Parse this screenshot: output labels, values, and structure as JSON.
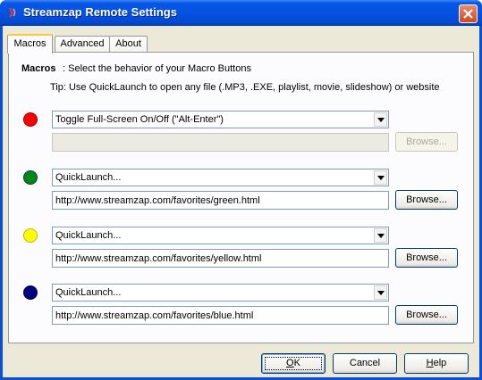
{
  "window": {
    "title": "Streamzap Remote Settings"
  },
  "tabs": [
    {
      "label": "Macros"
    },
    {
      "label": "Advanced"
    },
    {
      "label": "About"
    }
  ],
  "macros": {
    "heading": "Macros",
    "description": ": Select the behavior of your Macro Buttons",
    "tip": "Tip: Use QuickLaunch to open any file (.MP3, .EXE, playlist, movie, slideshow) or website",
    "rows": [
      {
        "color_name": "red",
        "color": "#ff0000",
        "action": "Toggle Full-Screen On/Off (\"Alt-Enter\")",
        "path": "",
        "path_enabled": false,
        "browse_label": "Browse..."
      },
      {
        "color_name": "green",
        "color": "#00861e",
        "action": "QuickLaunch...",
        "path": "http://www.streamzap.com/favorites/green.html",
        "path_enabled": true,
        "browse_label": "Browse..."
      },
      {
        "color_name": "yellow",
        "color": "#ffff00",
        "action": "QuickLaunch...",
        "path": "http://www.streamzap.com/favorites/yellow.html",
        "path_enabled": true,
        "browse_label": "Browse..."
      },
      {
        "color_name": "blue",
        "color": "#000080",
        "action": "QuickLaunch...",
        "path": "http://www.streamzap.com/favorites/blue.html",
        "path_enabled": true,
        "browse_label": "Browse..."
      }
    ]
  },
  "buttons": {
    "ok": {
      "pre": "",
      "u": "O",
      "post": "K"
    },
    "cancel": "Cancel",
    "help": {
      "pre": "",
      "u": "H",
      "post": "elp"
    }
  },
  "icons": {
    "app": "streamzap-logo-icon",
    "close": "close-x-icon",
    "dropdown": "dropdown-arrow-icon"
  }
}
